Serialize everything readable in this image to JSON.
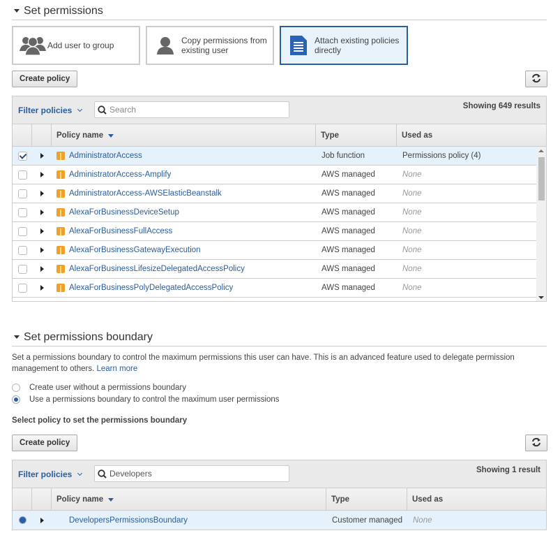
{
  "set_permissions": {
    "title": "Set permissions",
    "tiles": [
      {
        "label": "Add user to group",
        "icon": "users-group-icon",
        "selected": false
      },
      {
        "label": "Copy permissions from existing user",
        "icon": "user-icon",
        "selected": false
      },
      {
        "label": "Attach existing policies directly",
        "icon": "document-icon",
        "selected": true
      }
    ],
    "create_policy_label": "Create policy",
    "refresh_icon": "refresh-icon",
    "filter_label": "Filter policies",
    "search_placeholder": "Search",
    "search_value": "",
    "results_text": "Showing 649 results",
    "columns": [
      "Policy name",
      "Type",
      "Used as"
    ],
    "rows": [
      {
        "name": "AdministratorAccess",
        "type": "Job function",
        "used_as": "Permissions policy (4)",
        "checked": true
      },
      {
        "name": "AdministratorAccess-Amplify",
        "type": "AWS managed",
        "used_as": "None",
        "checked": false
      },
      {
        "name": "AdministratorAccess-AWSElasticBeanstalk",
        "type": "AWS managed",
        "used_as": "None",
        "checked": false
      },
      {
        "name": "AlexaForBusinessDeviceSetup",
        "type": "AWS managed",
        "used_as": "None",
        "checked": false
      },
      {
        "name": "AlexaForBusinessFullAccess",
        "type": "AWS managed",
        "used_as": "None",
        "checked": false
      },
      {
        "name": "AlexaForBusinessGatewayExecution",
        "type": "AWS managed",
        "used_as": "None",
        "checked": false
      },
      {
        "name": "AlexaForBusinessLifesizeDelegatedAccessPolicy",
        "type": "AWS managed",
        "used_as": "None",
        "checked": false
      },
      {
        "name": "AlexaForBusinessPolyDelegatedAccessPolicy",
        "type": "AWS managed",
        "used_as": "None",
        "checked": false
      }
    ]
  },
  "boundary": {
    "title": "Set permissions boundary",
    "description": "Set a permissions boundary to control the maximum permissions this user can have. This is an advanced feature used to delegate permission management to others.",
    "learn_more": "Learn more",
    "options": [
      {
        "label": "Create user without a permissions boundary",
        "selected": false
      },
      {
        "label": "Use a permissions boundary to control the maximum user permissions",
        "selected": true
      }
    ],
    "select_label": "Select policy to set the permissions boundary",
    "create_policy_label": "Create policy",
    "filter_label": "Filter policies",
    "search_value": "Developers",
    "results_text": "Showing 1 result",
    "columns": [
      "Policy name",
      "Type",
      "Used as"
    ],
    "rows": [
      {
        "name": "DevelopersPermissionsBoundary",
        "type": "Customer managed",
        "used_as": "None",
        "selected": true
      }
    ]
  },
  "colors": {
    "accent": "#2a5d9f",
    "selected_tile_border": "#2e5f94",
    "selected_row_bg": "#e5f1fb",
    "policy_icon": "#f0a126"
  }
}
